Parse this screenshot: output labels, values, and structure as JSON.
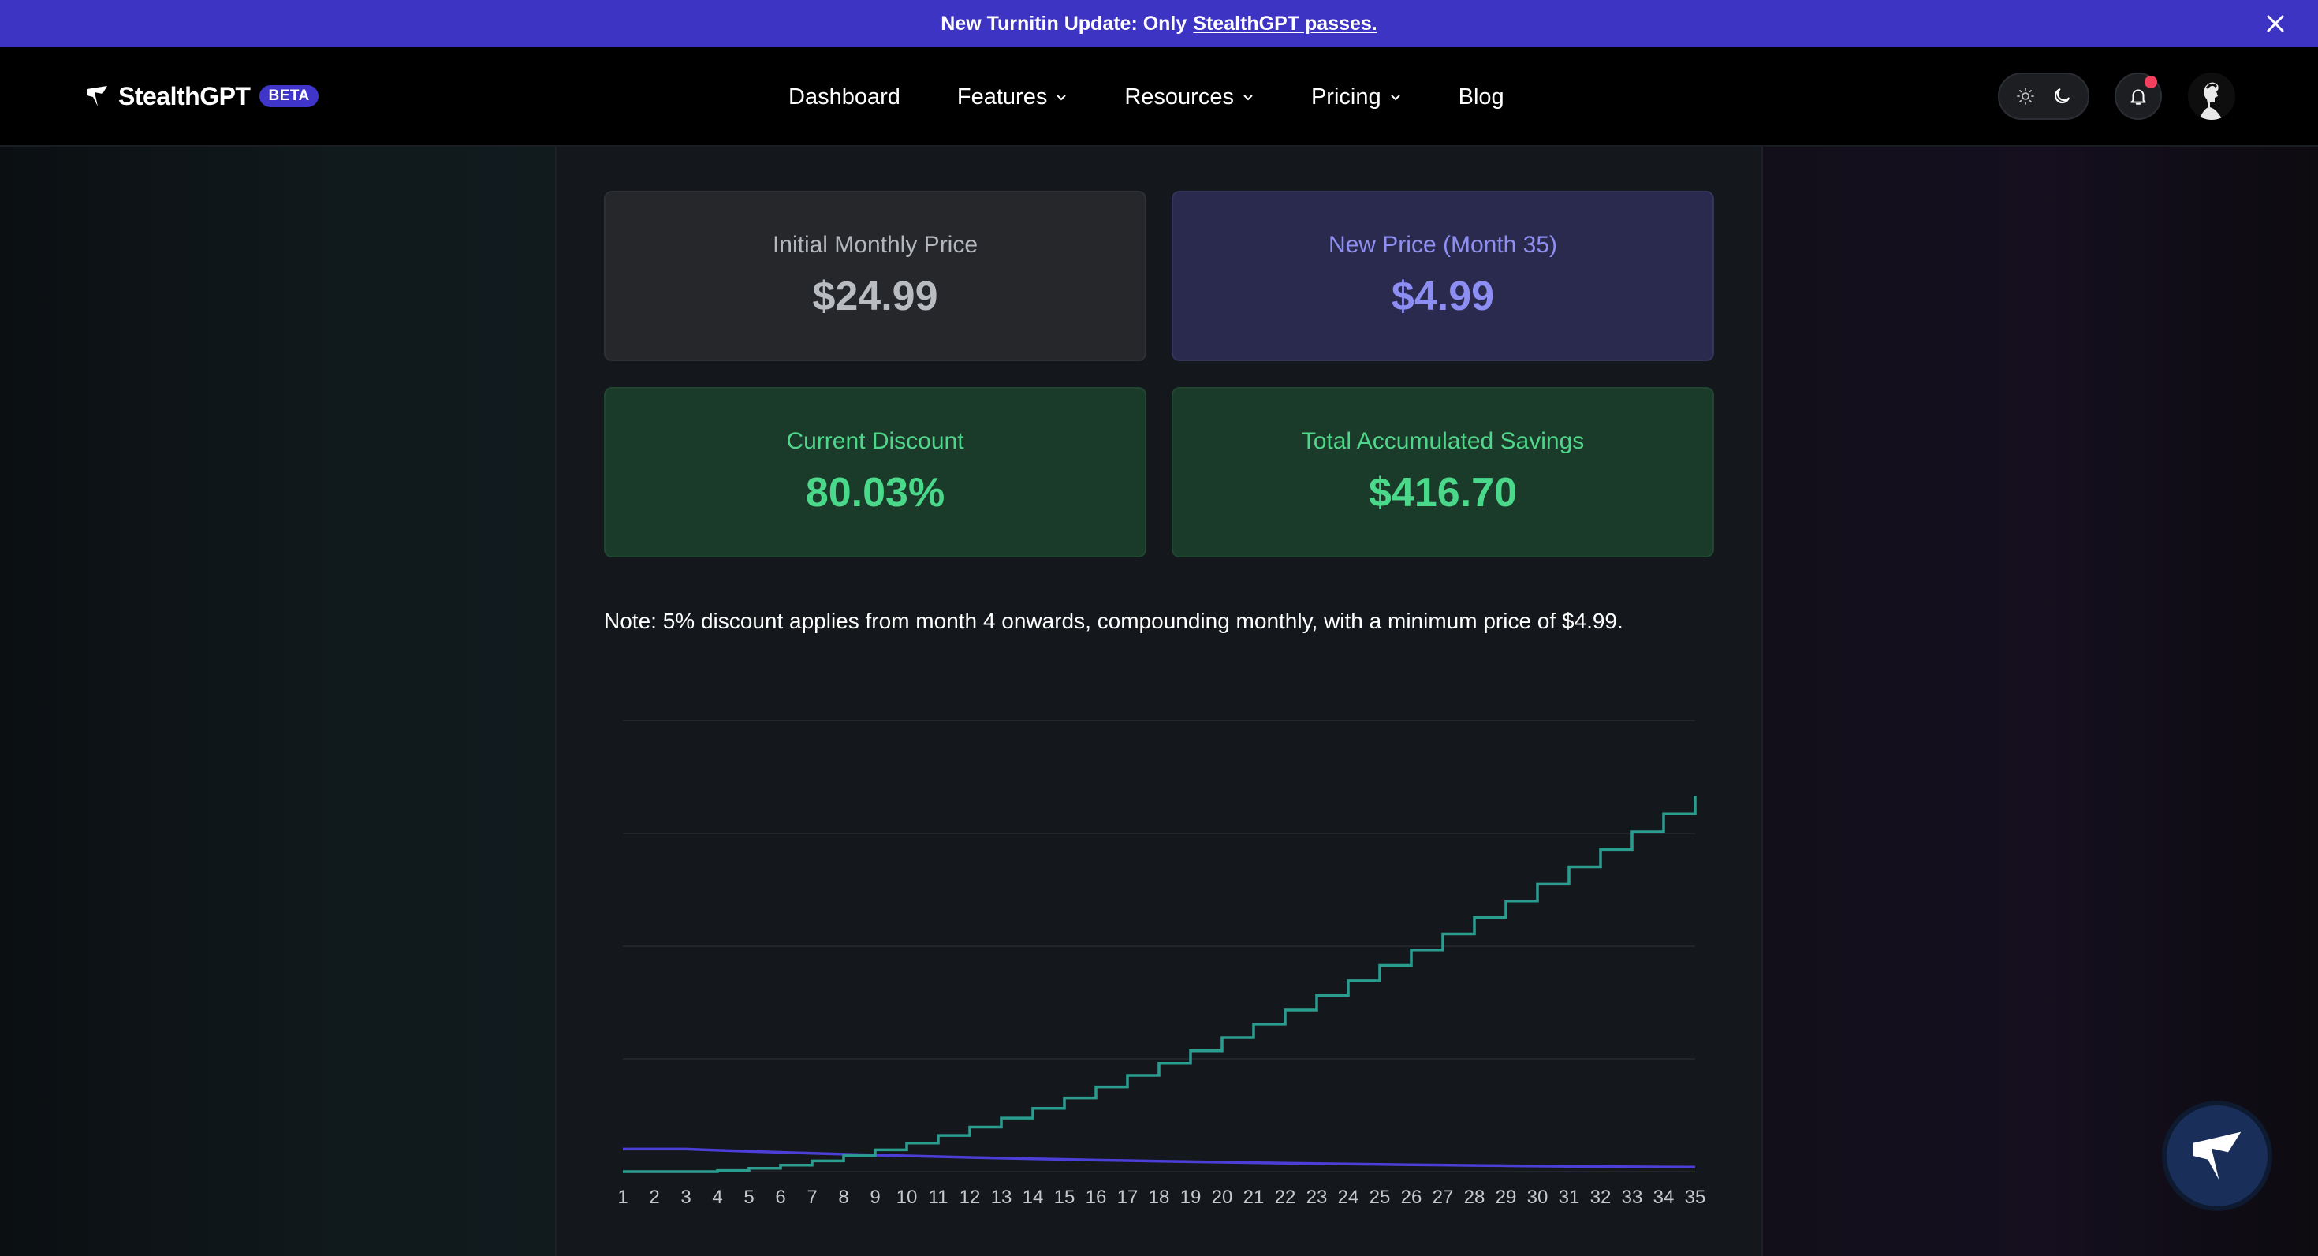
{
  "banner": {
    "text": "New Turnitin Update: Only",
    "link": "StealthGPT passes."
  },
  "nav": {
    "brand": "StealthGPT",
    "badge": "BETA",
    "links": [
      {
        "label": "Dashboard",
        "dropdown": false
      },
      {
        "label": "Features",
        "dropdown": true
      },
      {
        "label": "Resources",
        "dropdown": true
      },
      {
        "label": "Pricing",
        "dropdown": true
      },
      {
        "label": "Blog",
        "dropdown": false
      }
    ],
    "icons": [
      "sun-icon",
      "moon-icon",
      "bell-icon",
      "avatar"
    ]
  },
  "cards": {
    "initial": {
      "label": "Initial Monthly Price",
      "value": "$24.99"
    },
    "new_price": {
      "label": "New Price (Month 35)",
      "value": "$4.99"
    },
    "discount": {
      "label": "Current Discount",
      "value": "80.03%"
    },
    "savings": {
      "label": "Total Accumulated Savings",
      "value": "$416.70"
    }
  },
  "note": "Note: 5% discount applies from month 4 onwards, compounding monthly, with a minimum price of $4.99.",
  "colors": {
    "accent": "#3e34c4",
    "savings_line": "#2a9d8f",
    "price_line": "#4b3fd8",
    "green": "#4ad88a",
    "purple": "#8d8ef4"
  },
  "chart_data": {
    "type": "line",
    "x": [
      1,
      2,
      3,
      4,
      5,
      6,
      7,
      8,
      9,
      10,
      11,
      12,
      13,
      14,
      15,
      16,
      17,
      18,
      19,
      20,
      21,
      22,
      23,
      24,
      25,
      26,
      27,
      28,
      29,
      30,
      31,
      32,
      33,
      34,
      35
    ],
    "series": [
      {
        "values": [
          24.99,
          24.99,
          24.99,
          23.74,
          22.55,
          21.43,
          20.35,
          19.34,
          18.37,
          17.45,
          16.58,
          15.75,
          14.96,
          14.21,
          13.5,
          12.83,
          12.19,
          11.58,
          11.0,
          10.45,
          9.93,
          9.43,
          8.96,
          8.51,
          8.09,
          7.68,
          7.3,
          6.93,
          6.59,
          6.26,
          5.94,
          5.65,
          5.36,
          5.1,
          4.99
        ],
        "step": false
      },
      {
        "values": [
          0,
          0,
          0,
          1.25,
          2.44,
          3.56,
          4.64,
          5.65,
          6.62,
          7.54,
          8.41,
          9.24,
          10.03,
          10.78,
          11.49,
          12.16,
          12.8,
          13.41,
          13.99,
          14.54,
          15.06,
          15.56,
          16.03,
          16.48,
          16.9,
          17.31,
          17.69,
          18.06,
          18.4,
          18.73,
          19.05,
          19.34,
          19.63,
          19.89,
          20.0
        ],
        "step": true,
        "cumulative": true
      }
    ],
    "ylim": [
      0,
      500
    ],
    "grid": true,
    "xticks": [
      "1",
      "2",
      "3",
      "4",
      "5",
      "6",
      "7",
      "8",
      "9",
      "10",
      "11",
      "12",
      "13",
      "14",
      "15",
      "16",
      "17",
      "18",
      "19",
      "20",
      "21",
      "22",
      "23",
      "24",
      "25",
      "26",
      "27",
      "28",
      "29",
      "30",
      "31",
      "32",
      "33",
      "34",
      "35"
    ]
  }
}
